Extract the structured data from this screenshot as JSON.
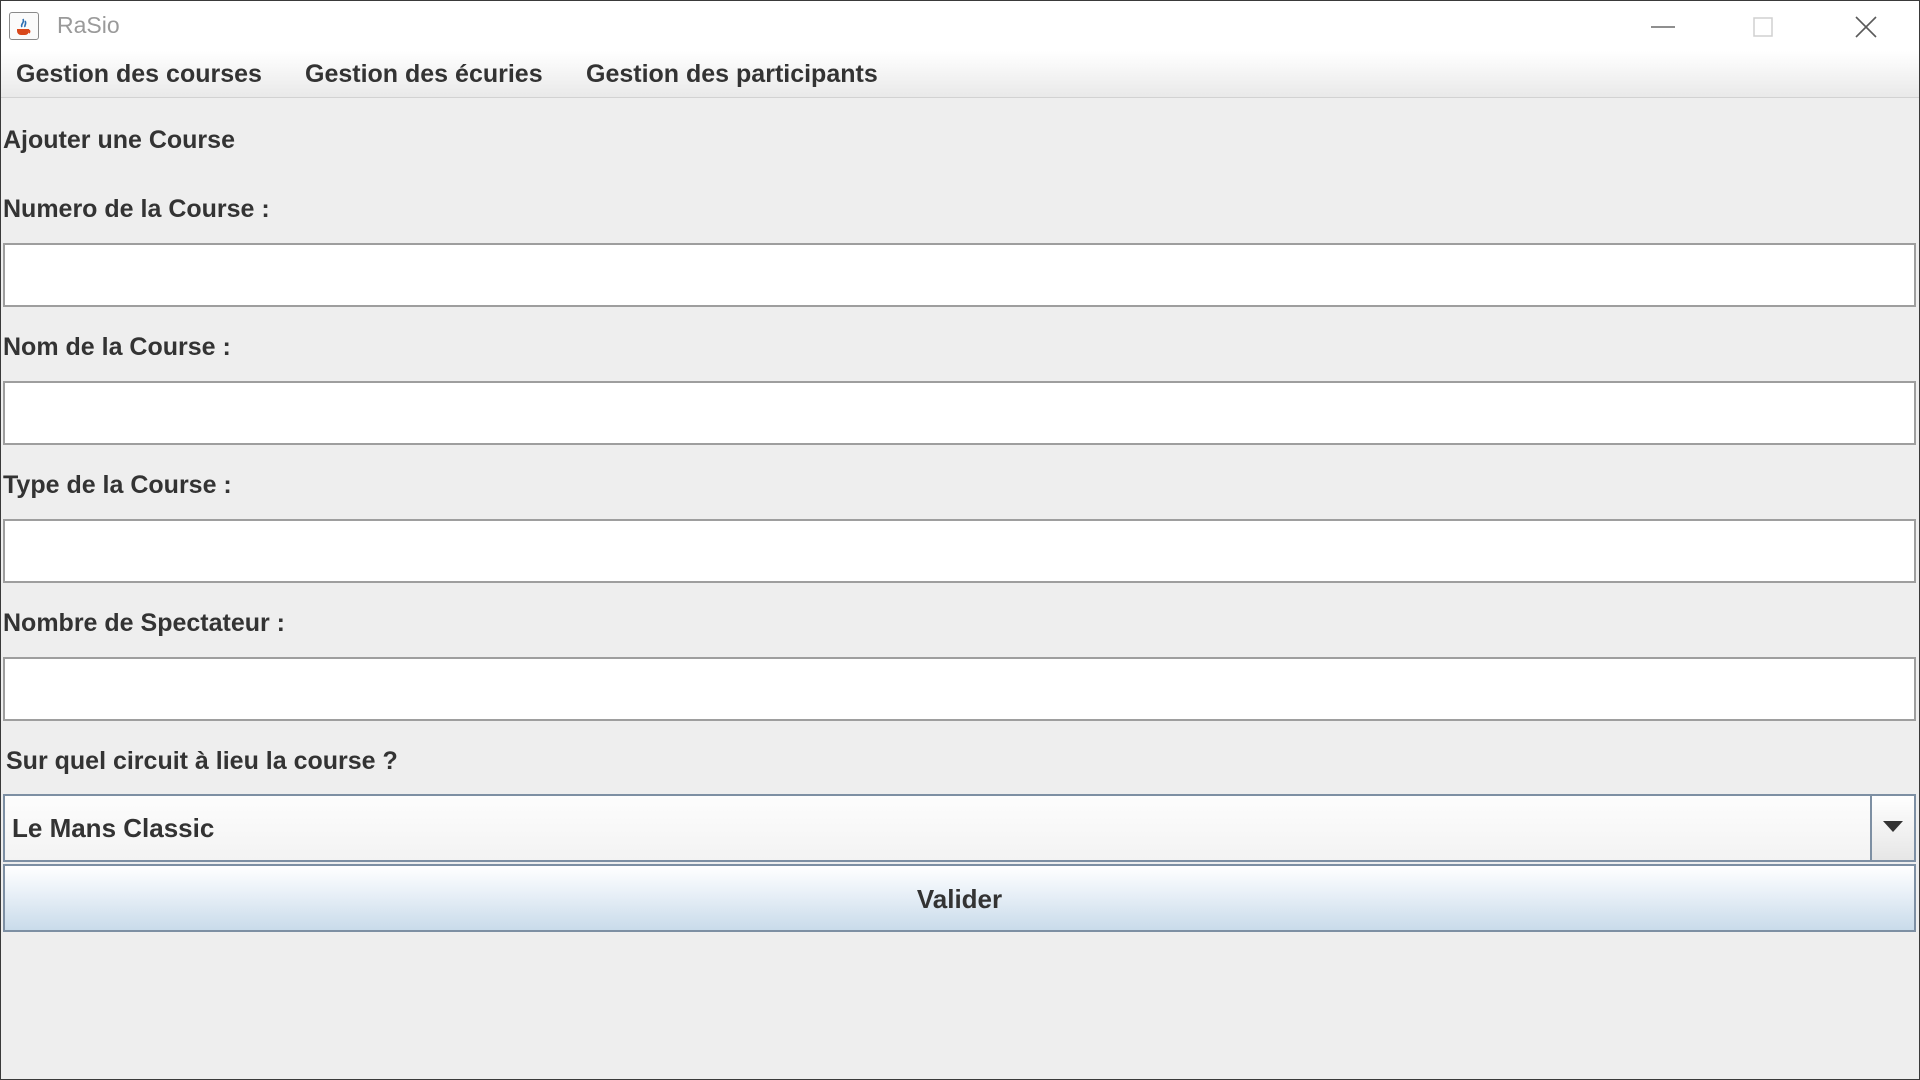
{
  "window": {
    "title": "RaSio"
  },
  "menu": [
    {
      "label": "Gestion des courses"
    },
    {
      "label": "Gestion des écuries"
    },
    {
      "label": "Gestion des participants"
    }
  ],
  "form": {
    "heading": "Ajouter une Course",
    "numero_label": "Numero de la Course :",
    "numero_value": "",
    "nom_label": "Nom de la Course :",
    "nom_value": "",
    "type_label": "Type de la Course :",
    "type_value": "",
    "spectateurs_label": "Nombre de Spectateur :",
    "spectateurs_value": "",
    "circuit_label": "Sur quel circuit à lieu la course ?",
    "circuit_selected": "Le Mans Classic",
    "submit_label": "Valider"
  },
  "icons": {
    "app": "java-cup-icon",
    "minimize": "minimize-icon",
    "maximize": "maximize-icon",
    "close": "close-icon",
    "dropdown": "chevron-down-icon"
  }
}
